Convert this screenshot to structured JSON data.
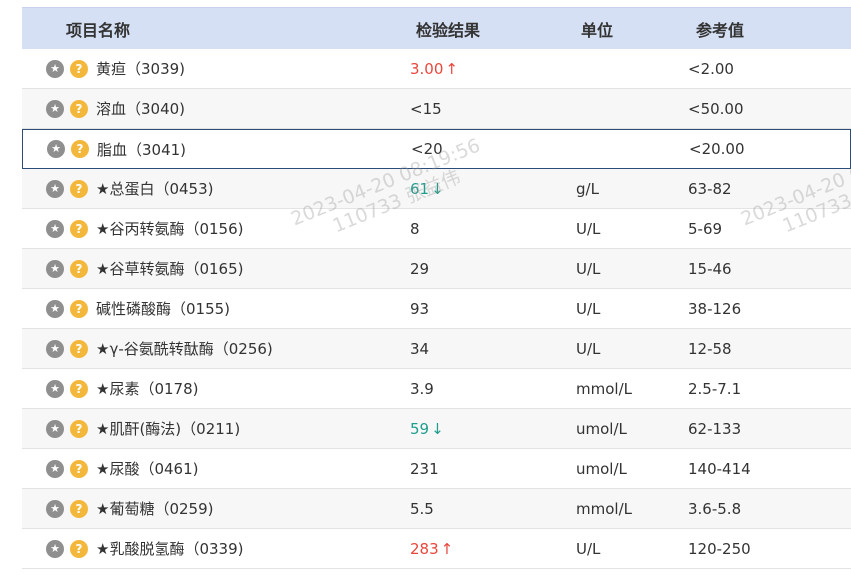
{
  "header": {
    "name": "项目名称",
    "result": "检验结果",
    "unit": "单位",
    "ref": "参考值"
  },
  "rows": [
    {
      "name": "黄疸（3039)",
      "result": "3.00",
      "flag": "high",
      "arrow": "↑",
      "unit": "",
      "ref": "<2.00"
    },
    {
      "name": "溶血（3040)",
      "result": "<15",
      "flag": "",
      "arrow": "",
      "unit": "",
      "ref": "<50.00"
    },
    {
      "name": "脂血（3041)",
      "result": "<20",
      "flag": "",
      "arrow": "",
      "unit": "",
      "ref": "<20.00"
    },
    {
      "name": "★总蛋白（0453)",
      "result": "61",
      "flag": "low",
      "arrow": "↓",
      "unit": "g/L",
      "ref": "63-82"
    },
    {
      "name": "★谷丙转氨酶（0156)",
      "result": "8",
      "flag": "",
      "arrow": "",
      "unit": "U/L",
      "ref": "5-69"
    },
    {
      "name": "★谷草转氨酶（0165)",
      "result": "29",
      "flag": "",
      "arrow": "",
      "unit": "U/L",
      "ref": "15-46"
    },
    {
      "name": "碱性磷酸酶（0155)",
      "result": "93",
      "flag": "",
      "arrow": "",
      "unit": "U/L",
      "ref": "38-126"
    },
    {
      "name": "★γ-谷氨酰转酞酶（0256)",
      "result": "34",
      "flag": "",
      "arrow": "",
      "unit": "U/L",
      "ref": "12-58"
    },
    {
      "name": "★尿素（0178)",
      "result": "3.9",
      "flag": "",
      "arrow": "",
      "unit": "mmol/L",
      "ref": "2.5-7.1"
    },
    {
      "name": "★肌酐(酶法)（0211)",
      "result": "59",
      "flag": "low",
      "arrow": "↓",
      "unit": "umol/L",
      "ref": "62-133"
    },
    {
      "name": "★尿酸（0461)",
      "result": "231",
      "flag": "",
      "arrow": "",
      "unit": "umol/L",
      "ref": "140-414"
    },
    {
      "name": "★葡萄糖（0259)",
      "result": "5.5",
      "flag": "",
      "arrow": "",
      "unit": "mmol/L",
      "ref": "3.6-5.8"
    },
    {
      "name": "★乳酸脱氢酶（0339)",
      "result": "283",
      "flag": "high",
      "arrow": "↑",
      "unit": "U/L",
      "ref": "120-250"
    }
  ],
  "icons": {
    "star": "star-icon",
    "question": "question-icon"
  },
  "watermark": {
    "line1": "2023-04-20 08:19:56",
    "line2": "110733 张益伟"
  },
  "colors": {
    "header_bg": "#d6e0f5",
    "high": "#e8473c",
    "low": "#1f9e8d",
    "icon_star": "#8f8f8f",
    "icon_q": "#f3b73b"
  }
}
